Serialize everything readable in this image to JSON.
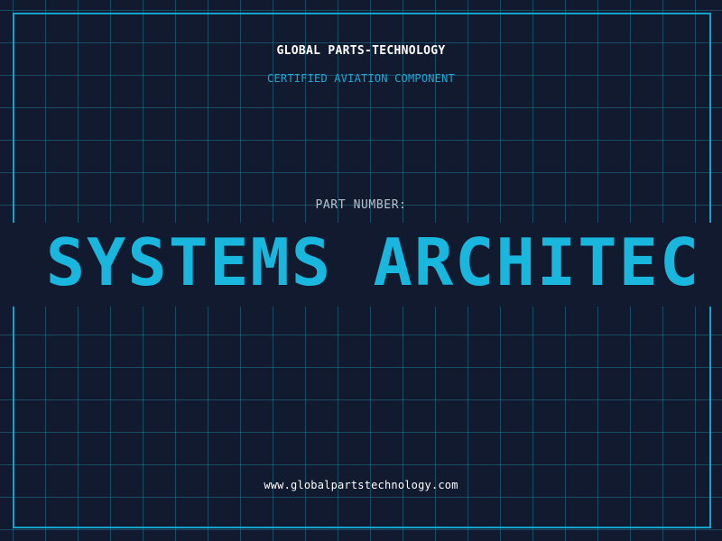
{
  "header": {
    "company": "GLOBAL PARTS-TECHNOLOGY",
    "certification": "CERTIFIED AVIATION COMPONENT"
  },
  "part": {
    "label": "PART NUMBER:",
    "marquee_text": "N SYSTEMS ARCHITEC"
  },
  "footer": {
    "website": "www.globalpartstechnology.com"
  },
  "colors": {
    "background": "#111a2e",
    "accent": "#19b6dd",
    "frame": "#14a3cc",
    "grid": "#207691",
    "text_primary": "#ffffff",
    "text_muted": "#b7c0cc"
  }
}
